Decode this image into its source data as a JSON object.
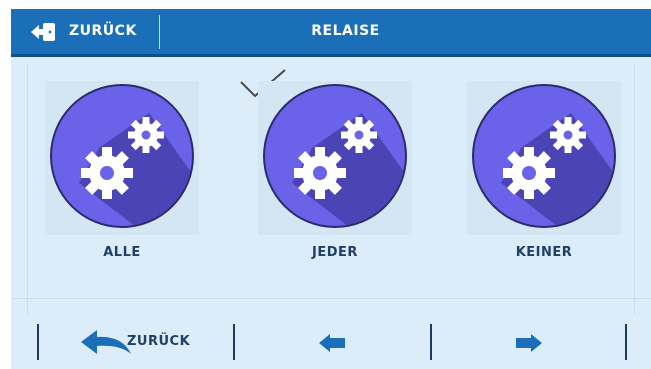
{
  "header": {
    "back_label": "ZURÜCK",
    "title": "RELAISE"
  },
  "options": [
    {
      "label": "ALLE",
      "icon": "gears-icon",
      "selected": false
    },
    {
      "label": "JEDER",
      "icon": "gears-icon",
      "selected": true
    },
    {
      "label": "KEINER",
      "icon": "gears-icon",
      "selected": false
    }
  ],
  "footer": {
    "back_label": "ZURÜCK",
    "back_icon": "curved-back-arrow-icon",
    "prev_icon": "arrow-left-icon",
    "next_icon": "arrow-right-icon"
  },
  "colors": {
    "header_bg": "#1a6fb8",
    "screen_bg": "#dcecf8",
    "circle": "#6a62e8",
    "circle_shadow": "#4a44b4",
    "circle_ring": "#2d2a6e",
    "accent": "#1a6fb8",
    "text_dark": "#1f3f66"
  }
}
